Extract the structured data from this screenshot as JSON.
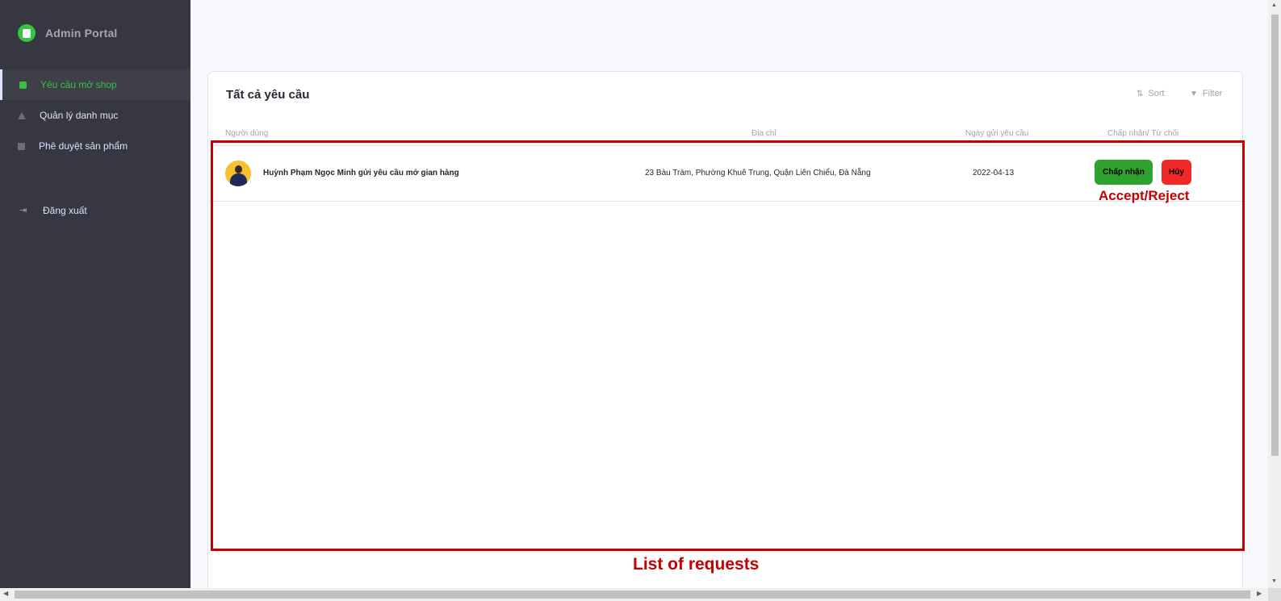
{
  "sidebar": {
    "brand": "Admin Portal",
    "items": [
      {
        "label": "Yêu cầu mở shop",
        "icon": "shop-request-icon",
        "active": true
      },
      {
        "label": "Quản lý danh mục",
        "icon": "category-icon",
        "active": false
      },
      {
        "label": "Phê duyệt sản phẩm",
        "icon": "product-approval-icon",
        "active": false
      }
    ],
    "logout": {
      "label": "Đăng xuất",
      "icon": "logout-icon"
    }
  },
  "card": {
    "title": "Tất cả yêu cầu",
    "sort_label": "Sort",
    "filter_label": "Filter",
    "columns": [
      "Người dùng",
      "Địa chỉ",
      "Ngày gửi yêu cầu",
      "Chấp nhận/ Từ chối"
    ],
    "rows": [
      {
        "user": "Huỳnh Phạm Ngọc Minh gửi yêu cầu mở gian hàng",
        "address": "23 Bàu Tràm, Phường Khuê Trung, Quận Liên Chiểu, Đà Nẵng",
        "date": "2022-04-13",
        "accept_label": "Chấp nhận",
        "reject_label": "Hủy"
      }
    ]
  },
  "annotations": {
    "accept_reject": "Accept/Reject",
    "list_label": "List of requests"
  },
  "colors": {
    "sidebar_bg": "#363740",
    "accent_green": "#3ac341",
    "accept_button": "#2fa12f",
    "reject_button": "#f02828",
    "annotation_red": "#c40000"
  }
}
